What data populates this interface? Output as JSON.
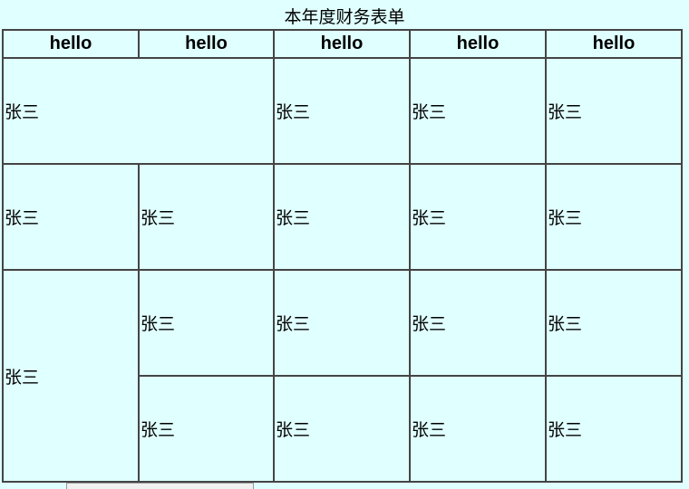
{
  "table": {
    "caption": "本年度财务表单",
    "headers": [
      "hello",
      "hello",
      "hello",
      "hello",
      "hello"
    ],
    "rows": [
      [
        "张三",
        "张三",
        "张三",
        "张三"
      ],
      [
        "张三",
        "张三",
        "张三",
        "张三",
        "张三"
      ],
      [
        "张三",
        "张三",
        "张三",
        "张三",
        "张三"
      ],
      [
        "张三",
        "张三",
        "张三",
        "张三"
      ]
    ]
  }
}
